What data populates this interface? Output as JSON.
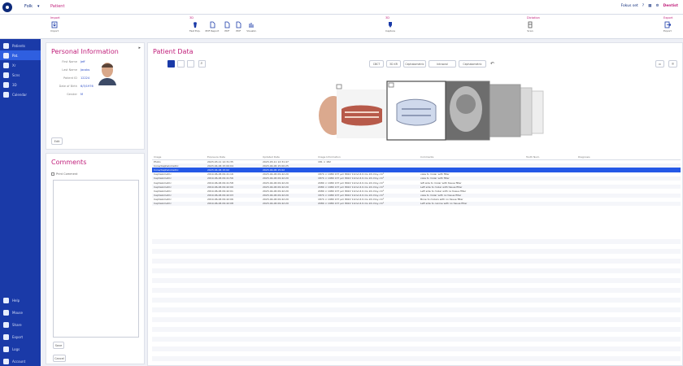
{
  "topbar": {
    "menu_label": "Folk",
    "module_title": "Patient",
    "status_text": "Fokus set",
    "user_name": "Dentist"
  },
  "ribbon": {
    "groups": [
      {
        "title": "Import",
        "buttons": [
          "Import"
        ]
      },
      {
        "title": "3D",
        "buttons": [
          "Fast Exp.",
          "PDF Report",
          "PDF",
          "PDF",
          "Visualiz."
        ]
      },
      {
        "title": "3D",
        "buttons": [
          "Capture"
        ]
      },
      {
        "title": "Dictation",
        "buttons": [
          "Scan"
        ]
      },
      {
        "title": "Export",
        "buttons": [
          "Export"
        ]
      }
    ]
  },
  "nav": {
    "items_top": [
      "Patients",
      "Pat.",
      "Xr",
      "Scns",
      "3D",
      "Calendar"
    ],
    "items_bottom": [
      "Help",
      "Mouse",
      "Share",
      "Export",
      "Logs",
      "Account"
    ],
    "active_index": 1
  },
  "personal": {
    "title": "Personal Information",
    "fields": [
      {
        "label": "First Name",
        "value": "Jeff"
      },
      {
        "label": "Last Name",
        "value": "Jacobs"
      },
      {
        "label": "Patient ID",
        "value": "12224"
      },
      {
        "label": "Date of Birth",
        "value": "6/3/1976"
      },
      {
        "label": "Gender",
        "value": "M"
      }
    ],
    "edit_label": "Edit"
  },
  "comments": {
    "title": "Comments",
    "checkbox_label": "Print Comment",
    "save_label": "Save",
    "cancel_label": "Cancel"
  },
  "patient_data": {
    "title": "Patient Data",
    "filters": [
      "CBCT",
      "3D XR",
      "Cephalometric",
      "Intraoral",
      "Cephalometric"
    ]
  },
  "table": {
    "columns": [
      "Image",
      "Exposure Date",
      "Updated Date",
      "Image Information",
      "Comments",
      "Tooth Num.",
      "Diagnosis"
    ],
    "rows": [
      [
        "Photo",
        "2023-03-11 12:31:35",
        "2023-03-11 12:31:47",
        "181 × 182",
        "",
        "",
        ""
      ],
      [
        "Cone/Cephalometric",
        "2023-04-06 15:00:04",
        "2023-04-06 15:00:25",
        "",
        "",
        "",
        ""
      ],
      [
        "Cone/Cephalometric",
        "2023-04-06 15:02",
        "2023-04-06 15:02",
        "",
        "",
        "",
        ""
      ],
      [
        "Cephalometric",
        "2019-06-06 09:41:16",
        "2023-04-06 09:42:20",
        "1874 × 1980 137 µm 80kV 11mA 6.9 ms 24 mGy·cm²",
        "view to molar with filter",
        "",
        ""
      ],
      [
        "Cephalometric",
        "2019-06-06 09:41:56",
        "2023-04-06 09:42:20",
        "1874 × 1980 137 µm 80kV 11mA 6.9 ms 24 mGy·cm²",
        "view to molar with filter",
        "",
        ""
      ],
      [
        "Cephalometric",
        "2019-06-06 09:41:58",
        "2023-04-06 09:42:20",
        "2080 × 1980 137 µm 80kV 11mA 6.9 ms 24 mGy·cm²",
        "left side to molar with tissue filter",
        "",
        ""
      ],
      [
        "Cephalometric",
        "2019-06-06 09:42:00",
        "2023-04-06 09:42:20",
        "2080 × 1980 137 µm 80kV 11mA 6.9 ms 24 mGy·cm²",
        "Left side to molar with tissue filter",
        "",
        ""
      ],
      [
        "Cephalometric",
        "2019-06-06 09:42:01",
        "2023-04-06 09:42:20",
        "2080 × 1980 137 µm 80kV 11mA 6.9 ms 24 mGy·cm²",
        "Left side to molar with no tissue filter",
        "",
        ""
      ],
      [
        "Cephalometric",
        "2019-06-06 09:42:03",
        "2023-04-06 09:42:20",
        "1874 × 1980 137 µm 80kV 11mA 6.9 ms 24 mGy·cm²",
        "view to molar with no tissue filter",
        "",
        ""
      ],
      [
        "Cephalometric",
        "2019-06-06 09:42:06",
        "2023-04-06 09:42:20",
        "1874 × 1980 137 µm 80kV 11mA 6.9 ms 24 mGy·cm²",
        "Bone to molars with no tissue filter",
        "",
        ""
      ],
      [
        "Cephalometric",
        "2019-06-06 09:42:08",
        "2023-04-06 09:42:20",
        "2080 × 1980 137 µm 80kV 11mA 6.9 ms 24 mGy·cm²",
        "Left side to canine with no tissue filter",
        "",
        ""
      ]
    ],
    "selected_row": 2
  },
  "colors": {
    "accent": "#c01e7a",
    "nav": "#1a3aa8",
    "selection": "#2458e6"
  }
}
